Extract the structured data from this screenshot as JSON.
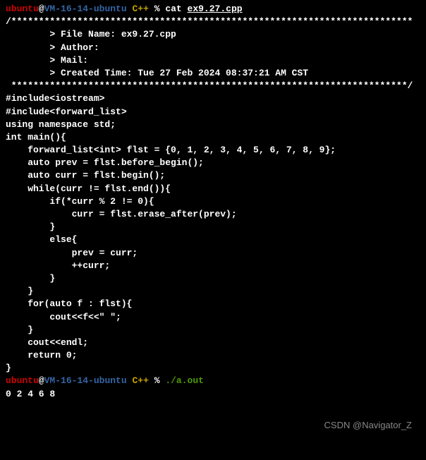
{
  "prompt1": {
    "user": "ubuntu",
    "at": "@",
    "host": "VM-16-14-ubuntu",
    "dir": "C++",
    "symbol": "%",
    "cmd": "cat",
    "arg": "ex9.27.cpp"
  },
  "header_border_top": "/*************************************************************************",
  "file_info": {
    "name_line": "        > File Name: ex9.27.cpp",
    "author_line": "        > Author:",
    "mail_line": "        > Mail:",
    "created_line": "        > Created Time: Tue 27 Feb 2024 08:37:21 AM CST"
  },
  "header_border_bottom": " ************************************************************************/",
  "code": {
    "blank1": "",
    "l1": "#include<iostream>",
    "l2": "#include<forward_list>",
    "l3": "using namespace std;",
    "blank2": "",
    "l4": "int main(){",
    "l5": "    forward_list<int> flst = {0, 1, 2, 3, 4, 5, 6, 7, 8, 9};",
    "l6": "    auto prev = flst.before_begin();",
    "l7": "    auto curr = flst.begin();",
    "l8": "    while(curr != flst.end()){",
    "l9": "        if(*curr % 2 != 0){",
    "l10": "            curr = flst.erase_after(prev);",
    "l11": "        }",
    "l12": "        else{",
    "l13": "            prev = curr;",
    "l14": "            ++curr;",
    "l15": "        }",
    "l16": "    }",
    "l17": "    for(auto f : flst){",
    "l18": "        cout<<f<<\" \";",
    "l19": "    }",
    "l20": "    cout<<endl;",
    "blank3": "",
    "l21": "    return 0;",
    "l22": "}"
  },
  "prompt2": {
    "user": "ubuntu",
    "at": "@",
    "host": "VM-16-14-ubuntu",
    "dir": "C++",
    "symbol": "%",
    "cmd": "./a.out"
  },
  "output": "0 2 4 6 8",
  "watermark": "CSDN @Navigator_Z"
}
